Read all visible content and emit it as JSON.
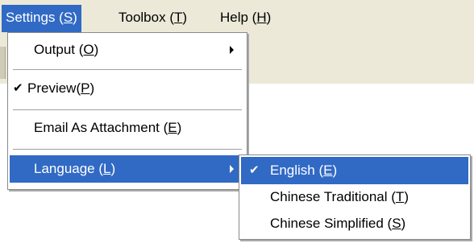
{
  "menubar": {
    "items": [
      {
        "label": "Settings (S)"
      },
      {
        "label": "Toolbox (T)"
      },
      {
        "label": "Help (H)"
      }
    ]
  },
  "settings_menu": {
    "items": [
      {
        "label": "Output (O)",
        "has_submenu": true
      },
      {
        "label": "Preview(P)",
        "checked": true
      },
      {
        "label": "Email As Attachment (E)"
      },
      {
        "label": "Language (L)",
        "has_submenu": true,
        "highlighted": true
      }
    ]
  },
  "language_menu": {
    "items": [
      {
        "label": "English (E)",
        "checked": true,
        "highlighted": true
      },
      {
        "label": "Chinese Traditional (T)"
      },
      {
        "label": "Chinese Simplified (S)"
      }
    ]
  },
  "icons": {
    "check": "check-icon",
    "submenu_arrow": "submenu-arrow-icon"
  },
  "colors": {
    "highlight": "#316ac5",
    "menubar_bg": "#ece9d8"
  }
}
